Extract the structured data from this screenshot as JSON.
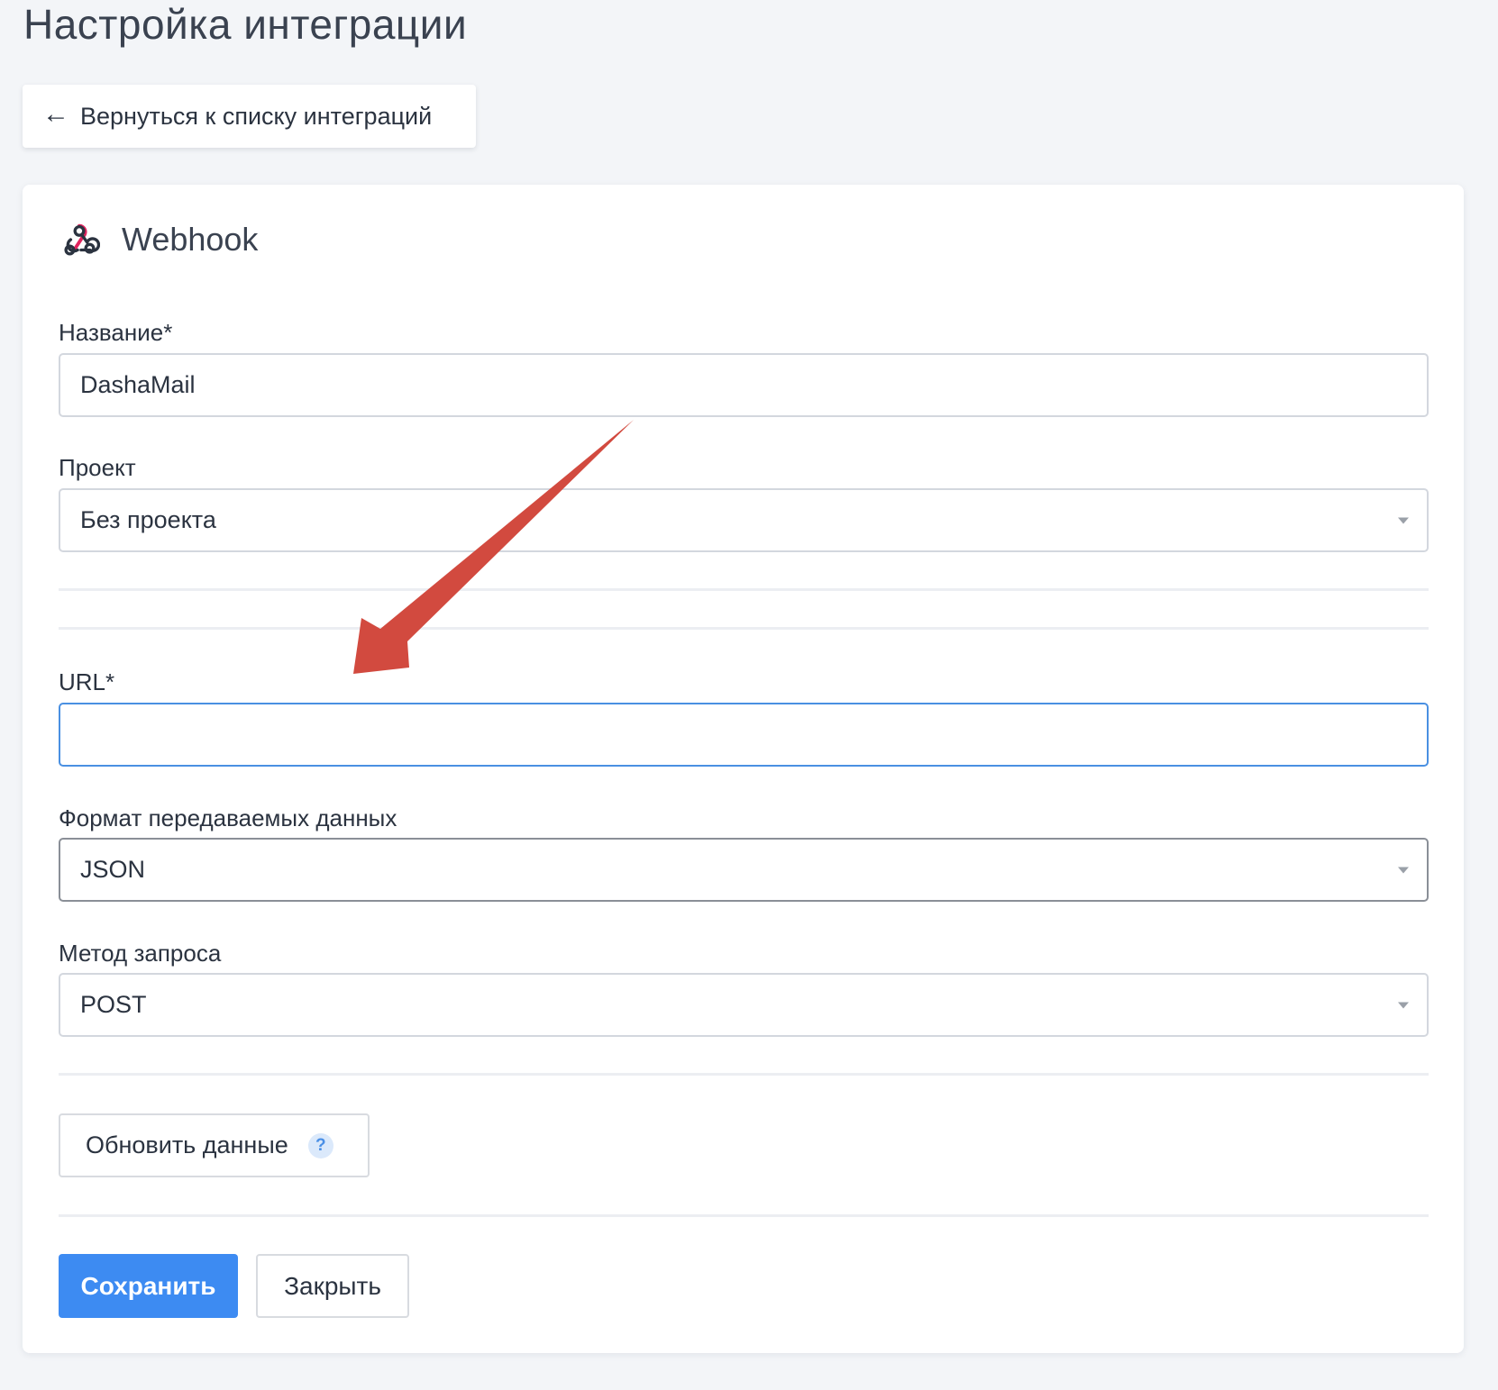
{
  "page": {
    "title": "Настройка интеграции",
    "back_label": "Вернуться к списку интеграций"
  },
  "card": {
    "title": "Webhook",
    "icon": "webhook-icon"
  },
  "fields": {
    "name": {
      "label": "Название*",
      "value": "DashaMail"
    },
    "project": {
      "label": "Проект",
      "value": "Без проекта"
    },
    "url": {
      "label": "URL*",
      "value": "",
      "placeholder": ""
    },
    "format": {
      "label": "Формат передаваемых данных",
      "value": "JSON"
    },
    "method": {
      "label": "Метод запроса",
      "value": "POST"
    }
  },
  "actions": {
    "refresh_label": "Обновить данные",
    "help_glyph": "?",
    "save_label": "Сохранить",
    "close_label": "Закрыть"
  },
  "colors": {
    "accent": "#3d8bf2",
    "annotation_arrow": "#d24a3f",
    "focus_border": "#4a90e2"
  }
}
